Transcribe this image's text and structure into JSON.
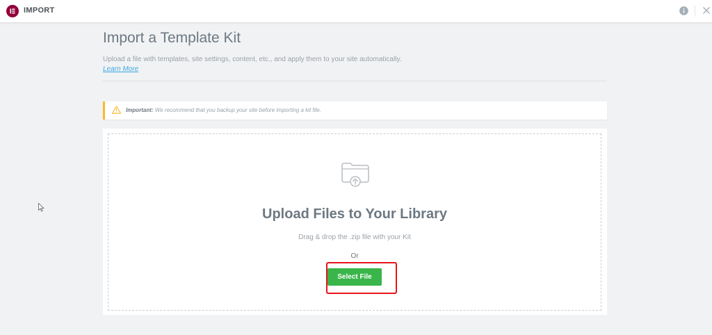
{
  "topbar": {
    "title": "IMPORT",
    "logo_icon": "elementor-logo-icon",
    "info_icon": "info-icon",
    "close_icon": "close-icon"
  },
  "header": {
    "title": "Import a Template Kit",
    "description": "Upload a file with templates, site settings, content, etc., and apply them to your site automatically.",
    "learn_more": "Learn More"
  },
  "notice": {
    "label": "Important:",
    "text": " We recommend that you backup your site before importing a kit file.",
    "icon": "warning-icon"
  },
  "upload": {
    "icon": "folder-upload-icon",
    "title": "Upload Files to Your Library",
    "subtitle": "Drag & drop the .zip file with your Kit",
    "or": "Or",
    "button_label": "Select File"
  },
  "colors": {
    "brand": "#92003b",
    "button": "#39b54a",
    "link": "#3da9e0",
    "warning": "#fcb92c",
    "highlight": "#e6141c"
  }
}
